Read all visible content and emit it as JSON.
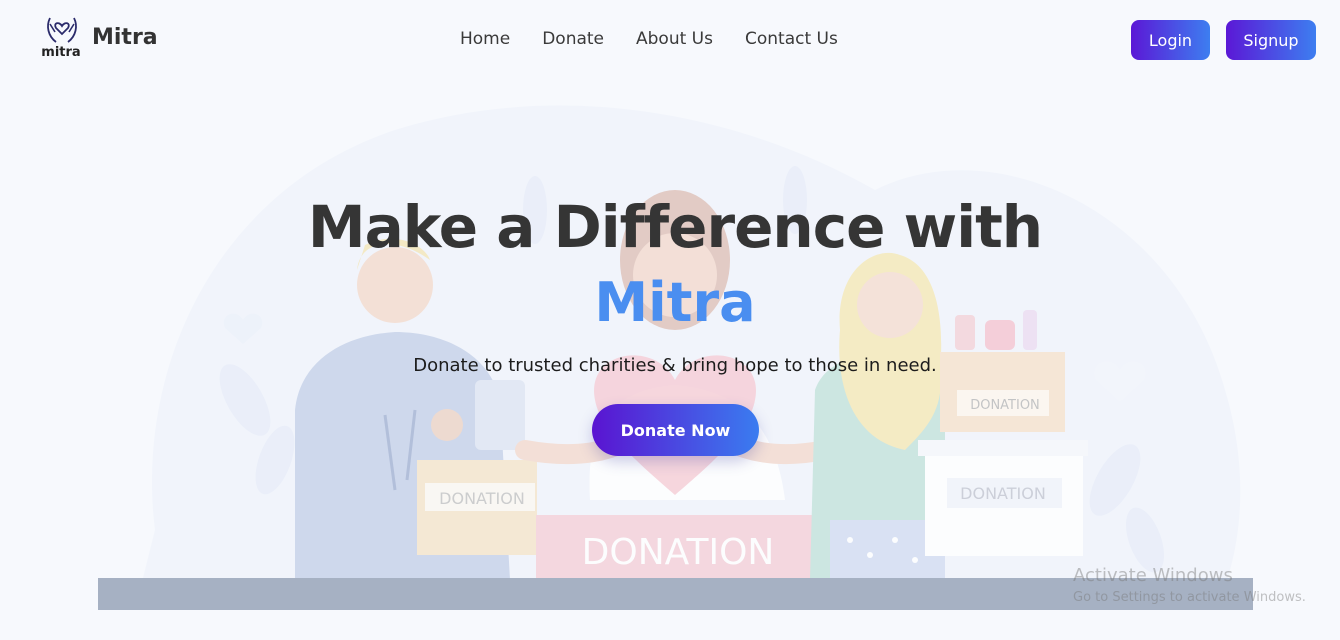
{
  "brand": {
    "mark_text": "mitra",
    "name": "Mitra"
  },
  "nav": {
    "items": [
      "Home",
      "Donate",
      "About Us",
      "Contact Us"
    ]
  },
  "auth": {
    "login_label": "Login",
    "signup_label": "Signup"
  },
  "hero": {
    "title": "Make a Difference with",
    "accent": "Mitra",
    "subtitle": "Donate to trusted charities & bring hope to those in need.",
    "cta_label": "Donate Now"
  },
  "illustration": {
    "box_left_label": "DONATION",
    "box_center_label": "DONATION",
    "box_right_top_label": "DONATION",
    "box_right_bottom_label": "DONATION"
  },
  "watermark": {
    "title": "Activate Windows",
    "subtitle": "Go to Settings to activate Windows."
  },
  "colors": {
    "accent": "#4a8ef0",
    "button_start": "#5a14d1",
    "button_end": "#3a7cf0",
    "heading": "#353535"
  }
}
